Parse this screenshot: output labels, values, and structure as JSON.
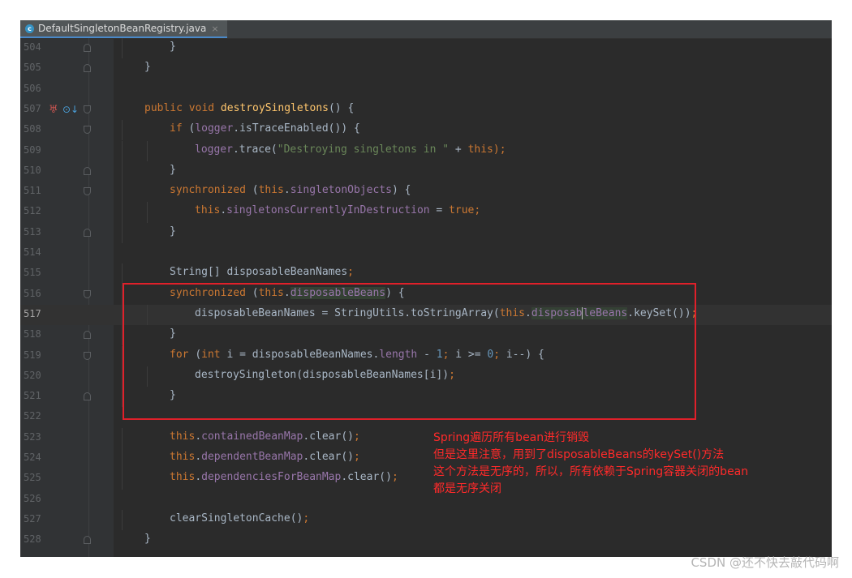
{
  "tab": {
    "icon": "class-icon",
    "icon_letter": "c",
    "filename": "DefaultSingletonBeanRegistry.java",
    "close": "×"
  },
  "lines": [
    {
      "num": "504",
      "fold": "end",
      "indent": 2,
      "tokens": [
        [
          "p",
          "}"
        ]
      ]
    },
    {
      "num": "505",
      "fold": "end",
      "indent": 1,
      "tokens": [
        [
          "p",
          "}"
        ]
      ]
    },
    {
      "num": "506",
      "fold": "",
      "indent": 0,
      "tokens": []
    },
    {
      "num": "507",
      "fold": "start",
      "indent": 1,
      "gutter_icons": true,
      "tokens": [
        [
          "kw",
          "public void "
        ],
        [
          "fn",
          "destroySingletons"
        ],
        [
          "p",
          "() {"
        ]
      ]
    },
    {
      "num": "508",
      "fold": "start",
      "indent": 2,
      "tokens": [
        [
          "kw",
          "if "
        ],
        [
          "p",
          "("
        ],
        [
          "fld",
          "logger"
        ],
        [
          "p",
          ".isTraceEnabled()) {"
        ]
      ]
    },
    {
      "num": "509",
      "fold": "",
      "indent": 3,
      "tokens": [
        [
          "fld",
          "logger"
        ],
        [
          "p",
          ".trace("
        ],
        [
          "str",
          "\"Destroying singletons in \""
        ],
        [
          "p",
          " + "
        ],
        [
          "kw",
          "this"
        ],
        [
          "kw",
          ")"
        ],
        [
          "kw",
          ";"
        ]
      ]
    },
    {
      "num": "510",
      "fold": "end",
      "indent": 2,
      "tokens": [
        [
          "p",
          "}"
        ]
      ]
    },
    {
      "num": "511",
      "fold": "start",
      "indent": 2,
      "tokens": [
        [
          "kw",
          "synchronized "
        ],
        [
          "p",
          "("
        ],
        [
          "kw",
          "this"
        ],
        [
          "p",
          "."
        ],
        [
          "fld",
          "singletonObjects"
        ],
        [
          "p",
          ") {"
        ]
      ]
    },
    {
      "num": "512",
      "fold": "",
      "indent": 3,
      "tokens": [
        [
          "kw",
          "this"
        ],
        [
          "p",
          "."
        ],
        [
          "fld",
          "singletonsCurrentlyInDestruction"
        ],
        [
          "p",
          " = "
        ],
        [
          "kw",
          "true"
        ],
        [
          "kw",
          ";"
        ]
      ]
    },
    {
      "num": "513",
      "fold": "end",
      "indent": 2,
      "tokens": [
        [
          "p",
          "}"
        ]
      ]
    },
    {
      "num": "514",
      "fold": "",
      "indent": 0,
      "tokens": []
    },
    {
      "num": "515",
      "fold": "",
      "indent": 2,
      "tokens": [
        [
          "p",
          "String[] disposableBeanNames"
        ],
        [
          "kw",
          ";"
        ]
      ]
    },
    {
      "num": "516",
      "fold": "start",
      "indent": 2,
      "tokens": [
        [
          "kw",
          "synchronized "
        ],
        [
          "p",
          "("
        ],
        [
          "kw",
          "this"
        ],
        [
          "p",
          "."
        ],
        [
          "fld hl",
          "disposableBeans"
        ],
        [
          "p",
          ") {"
        ]
      ]
    },
    {
      "num": "517",
      "fold": "",
      "indent": 3,
      "current": true,
      "tokens": [
        [
          "p",
          "disposableBeanNames = StringUtils."
        ],
        [
          "p",
          "toStringArray("
        ],
        [
          "kw",
          "this"
        ],
        [
          "p",
          "."
        ],
        [
          "fld hl",
          "disposab"
        ],
        [
          "fld hl caret",
          "leBeans"
        ],
        [
          "p",
          ".keySet())"
        ],
        [
          "kw",
          ";"
        ]
      ]
    },
    {
      "num": "518",
      "fold": "end",
      "indent": 2,
      "tokens": [
        [
          "p",
          "}"
        ]
      ]
    },
    {
      "num": "519",
      "fold": "start",
      "indent": 2,
      "tokens": [
        [
          "kw",
          "for "
        ],
        [
          "p",
          "("
        ],
        [
          "kw",
          "int "
        ],
        [
          "p",
          "i = disposableBeanNames."
        ],
        [
          "fld",
          "length"
        ],
        [
          "p",
          " - "
        ],
        [
          "num",
          "1"
        ],
        [
          "kw",
          "; "
        ],
        [
          "p",
          "i >= "
        ],
        [
          "num",
          "0"
        ],
        [
          "kw",
          "; "
        ],
        [
          "p",
          "i--) {"
        ]
      ]
    },
    {
      "num": "520",
      "fold": "",
      "indent": 3,
      "tokens": [
        [
          "p",
          "destroySingleton(disposableBeanNames[i])"
        ],
        [
          "kw",
          ";"
        ]
      ]
    },
    {
      "num": "521",
      "fold": "end",
      "indent": 2,
      "tokens": [
        [
          "p",
          "}"
        ]
      ]
    },
    {
      "num": "522",
      "fold": "",
      "indent": 0,
      "tokens": []
    },
    {
      "num": "523",
      "fold": "",
      "indent": 2,
      "tokens": [
        [
          "kw",
          "this"
        ],
        [
          "p",
          "."
        ],
        [
          "fld",
          "containedBeanMap"
        ],
        [
          "p",
          ".clear()"
        ],
        [
          "kw",
          ";"
        ]
      ]
    },
    {
      "num": "524",
      "fold": "",
      "indent": 2,
      "tokens": [
        [
          "kw",
          "this"
        ],
        [
          "p",
          "."
        ],
        [
          "fld",
          "dependentBeanMap"
        ],
        [
          "p",
          ".clear()"
        ],
        [
          "kw",
          ";"
        ]
      ]
    },
    {
      "num": "525",
      "fold": "",
      "indent": 2,
      "tokens": [
        [
          "kw",
          "this"
        ],
        [
          "p",
          "."
        ],
        [
          "fld",
          "dependenciesForBeanMap"
        ],
        [
          "p",
          ".clear()"
        ],
        [
          "kw",
          ";"
        ]
      ]
    },
    {
      "num": "526",
      "fold": "",
      "indent": 0,
      "tokens": []
    },
    {
      "num": "527",
      "fold": "",
      "indent": 2,
      "tokens": [
        [
          "p",
          "clearSingletonCache()"
        ],
        [
          "kw",
          ";"
        ]
      ]
    },
    {
      "num": "528",
      "fold": "end",
      "indent": 1,
      "tokens": [
        [
          "p",
          "}"
        ]
      ]
    }
  ],
  "gutter_icons": {
    "bug": "debug-marker-icon",
    "override": "overriding-method-icon",
    "bug_glyph": "♅",
    "override_glyph": "⊙↓"
  },
  "annotation": {
    "lines": [
      "Spring遍历所有bean进行销毁",
      "但是这里注意，用到了disposableBeans的keySet()方法",
      "这个方法是无序的，所以，所有依赖于Spring容器关闭的bean",
      "都是无序关闭"
    ],
    "color": "#ff2a2a"
  },
  "watermark": "CSDN @还不快去敲代码啊"
}
